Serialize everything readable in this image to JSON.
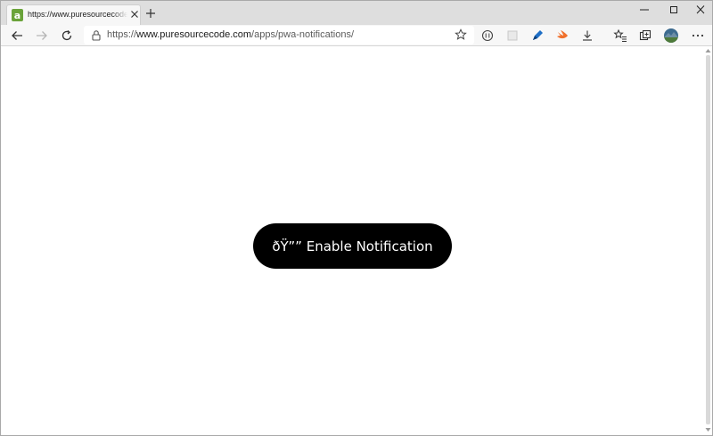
{
  "tab": {
    "title": "https://www.puresourcecode.com/apps/pwa-notifications/"
  },
  "address": {
    "scheme": "https://",
    "host": "www.puresourcecode.com",
    "path": "/apps/pwa-notifications/"
  },
  "page": {
    "button_label": "ðŸ”” Enable Notification"
  },
  "colors": {
    "button_bg": "#000000",
    "button_text": "#ffffff",
    "tab_strip": "#dedede",
    "toolbar": "#f7f7f7"
  },
  "icons": {
    "favicon": "site-favicon-icon",
    "tab_close": "close-icon",
    "new_tab": "plus-icon",
    "back": "arrow-left-icon",
    "forward": "arrow-right-icon",
    "refresh": "refresh-icon",
    "lock": "lock-icon",
    "favorite": "star-icon",
    "reading": "reader-mode-icon",
    "extension1": "square-extension-icon",
    "extension2": "pen-extension-icon",
    "extension3": "swift-extension-icon",
    "downloads": "download-icon",
    "favorites_bar": "favorites-icon",
    "collections": "collections-icon",
    "profile": "profile-avatar",
    "menu": "more-icon"
  }
}
